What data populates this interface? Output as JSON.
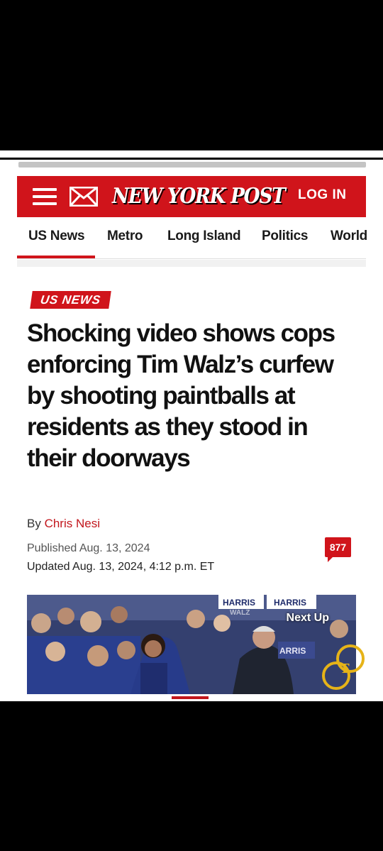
{
  "header": {
    "logo": "NEW YORK POST",
    "login_label": "LOG IN",
    "colors": {
      "brand": "#d0141b",
      "text_on_brand": "#ffffff"
    }
  },
  "nav": {
    "items": [
      "US News",
      "Metro",
      "Long Island",
      "Politics",
      "World"
    ]
  },
  "article": {
    "kicker": "US NEWS",
    "headline": "Shocking video shows cops enforcing Tim Walz’s curfew by shooting paintballs at residents as they stood in their doorways",
    "byline_prefix": "By",
    "author": "Chris Nesi",
    "published": "Published Aug. 13, 2024",
    "updated": "Updated Aug. 13, 2024, 4:12 p.m. ET",
    "comment_count": "877"
  },
  "media": {
    "next_up_label": "Next Up",
    "signs": [
      "HARRIS",
      "HARRIS",
      "WALZ",
      "ARRIS"
    ]
  },
  "icons": [
    "hamburger-icon",
    "mail-icon",
    "comment-bubble-icon",
    "watermark-logo"
  ]
}
